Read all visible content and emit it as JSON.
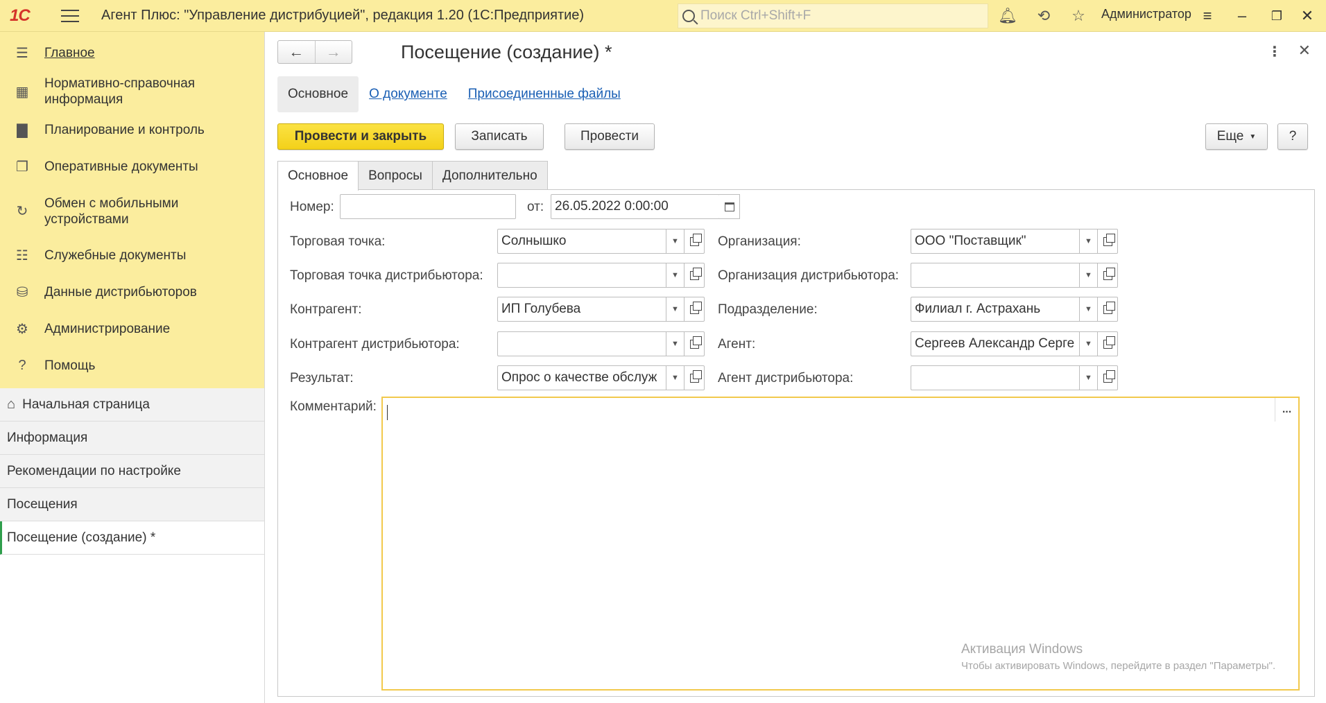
{
  "app": {
    "logo": "1С",
    "title": "Агент Плюс: \"Управление дистрибуцией\", редакция 1.20  (1С:Предприятие)",
    "search_placeholder": "Поиск Ctrl+Shift+F",
    "user": "Администратор"
  },
  "sidebar": {
    "sections": [
      {
        "label": "Главное",
        "icon": "menu-icon"
      },
      {
        "label": "Нормативно-справочная информация",
        "icon": "grid-icon"
      },
      {
        "label": "Планирование и контроль",
        "icon": "bar-chart-icon"
      },
      {
        "label": "Оперативные документы",
        "icon": "documents-icon"
      },
      {
        "label": "Обмен с мобильными устройствами",
        "icon": "sync-icon"
      },
      {
        "label": "Служебные документы",
        "icon": "service-docs-icon"
      },
      {
        "label": "Данные дистрибьюторов",
        "icon": "database-icon"
      },
      {
        "label": "Администрирование",
        "icon": "gear-icon"
      },
      {
        "label": "Помощь",
        "icon": "question-icon"
      }
    ],
    "open_windows": [
      {
        "label": "Начальная страница",
        "icon": "home-icon"
      },
      {
        "label": "Информация"
      },
      {
        "label": "Рекомендации по настройке"
      },
      {
        "label": "Посещения"
      },
      {
        "label": "Посещение (создание) *",
        "active": true
      }
    ]
  },
  "form": {
    "title": "Посещение (создание) *",
    "panel_tabs": [
      "Основное",
      "О документе",
      "Присоединенные файлы"
    ],
    "buttons": {
      "post_close": "Провести и закрыть",
      "save": "Записать",
      "post": "Провести",
      "more": "Еще",
      "help": "?"
    },
    "tabs": [
      "Основное",
      "Вопросы",
      "Дополнительно"
    ],
    "fields": {
      "number_label": "Номер:",
      "number_value": "",
      "date_label": "от:",
      "date_value": "26.05.2022  0:00:00",
      "outlet_label": "Торговая точка:",
      "outlet_value": "Солнышко",
      "dist_outlet_label": "Торговая точка дистрибьютора:",
      "dist_outlet_value": "",
      "counterparty_label": "Контрагент:",
      "counterparty_value": "ИП Голубева",
      "dist_counterparty_label": "Контрагент дистрибьютора:",
      "dist_counterparty_value": "",
      "result_label": "Результат:",
      "result_value": "Опрос о качестве обслуж",
      "org_label": "Организация:",
      "org_value": "ООО \"Поставщик\"",
      "dist_org_label": "Организация дистрибьютора:",
      "dist_org_value": "",
      "division_label": "Подразделение:",
      "division_value": "Филиал г. Астрахань",
      "agent_label": "Агент:",
      "agent_value": "Сергеев Александр Серге",
      "dist_agent_label": "Агент дистрибьютора:",
      "dist_agent_value": "",
      "comment_label": "Комментарий:",
      "comment_value": ""
    }
  },
  "watermark": {
    "line1": "Активация Windows",
    "line2": "Чтобы активировать Windows, перейдите в раздел \"Параметры\"."
  }
}
